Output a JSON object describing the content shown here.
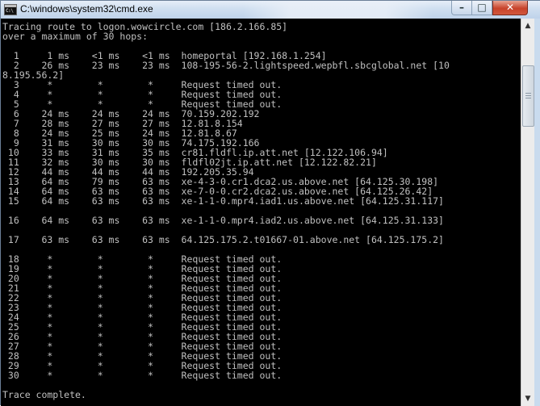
{
  "window": {
    "title": "C:\\windows\\system32\\cmd.exe",
    "icon_text": "C:\\"
  },
  "controls": {
    "minimize_icon": "minimize-icon",
    "maximize_icon": "maximize-icon",
    "close_icon": "close-icon"
  },
  "console": {
    "lines": [
      "Tracing route to logon.wowcircle.com [186.2.166.85]",
      "over a maximum of 30 hops:",
      "",
      "  1     1 ms    <1 ms    <1 ms  homeportal [192.168.1.254]",
      "  2    26 ms    23 ms    23 ms  108-195-56-2.lightspeed.wepbfl.sbcglobal.net [10",
      "8.195.56.2]",
      "  3     *        *        *     Request timed out.",
      "  4     *        *        *     Request timed out.",
      "  5     *        *        *     Request timed out.",
      "  6    24 ms    24 ms    24 ms  70.159.202.192",
      "  7    28 ms    27 ms    27 ms  12.81.8.154",
      "  8    24 ms    25 ms    24 ms  12.81.8.67",
      "  9    31 ms    30 ms    30 ms  74.175.192.166",
      " 10    33 ms    31 ms    35 ms  cr81.fldfl.ip.att.net [12.122.106.94]",
      " 11    32 ms    30 ms    30 ms  fldfl02jt.ip.att.net [12.122.82.21]",
      " 12    44 ms    44 ms    44 ms  192.205.35.94",
      " 13    64 ms    79 ms    63 ms  xe-4-3-0.cr1.dca2.us.above.net [64.125.30.198]",
      " 14    64 ms    63 ms    63 ms  xe-7-0-0.cr2.dca2.us.above.net [64.125.26.42]",
      " 15    64 ms    63 ms    63 ms  xe-1-1-0.mpr4.iad1.us.above.net [64.125.31.117]",
      "",
      " 16    64 ms    63 ms    63 ms  xe-1-1-0.mpr4.iad2.us.above.net [64.125.31.133]",
      "",
      " 17    63 ms    63 ms    63 ms  64.125.175.2.t01667-01.above.net [64.125.175.2]",
      "",
      " 18     *        *        *     Request timed out.",
      " 19     *        *        *     Request timed out.",
      " 20     *        *        *     Request timed out.",
      " 21     *        *        *     Request timed out.",
      " 22     *        *        *     Request timed out.",
      " 23     *        *        *     Request timed out.",
      " 24     *        *        *     Request timed out.",
      " 25     *        *        *     Request timed out.",
      " 26     *        *        *     Request timed out.",
      " 27     *        *        *     Request timed out.",
      " 28     *        *        *     Request timed out.",
      " 29     *        *        *     Request timed out.",
      " 30     *        *        *     Request timed out.",
      "",
      "Trace complete."
    ]
  }
}
